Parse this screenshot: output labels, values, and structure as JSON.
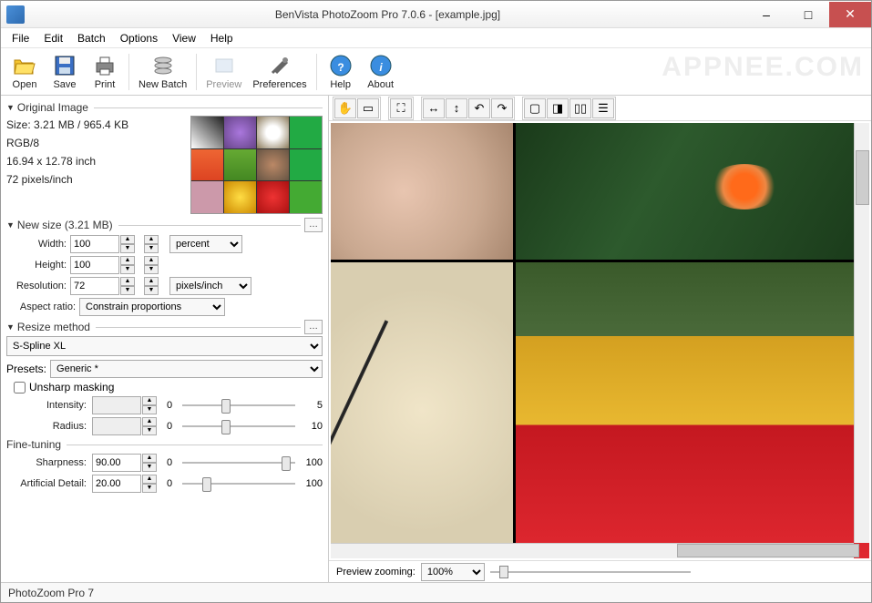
{
  "window": {
    "title": "BenVista PhotoZoom Pro 7.0.6 - [example.jpg]"
  },
  "menu": {
    "items": [
      "File",
      "Edit",
      "Batch",
      "Options",
      "View",
      "Help"
    ]
  },
  "toolbar": {
    "open": "Open",
    "save": "Save",
    "print": "Print",
    "newbatch": "New Batch",
    "preview": "Preview",
    "preferences": "Preferences",
    "help": "Help",
    "about": "About",
    "watermark": "APPNEE.COM"
  },
  "original": {
    "header": "Original Image",
    "size": "Size: 3.21 MB / 965.4 KB",
    "mode": "RGB/8",
    "dims": "16.94 x 12.78 inch",
    "res": "72 pixels/inch"
  },
  "newsize": {
    "header": "New size (3.21 MB)",
    "width_label": "Width:",
    "width": "100",
    "height_label": "Height:",
    "height": "100",
    "unit": "percent",
    "res_label": "Resolution:",
    "res": "72",
    "res_unit": "pixels/inch",
    "aspect_label": "Aspect ratio:",
    "aspect": "Constrain proportions"
  },
  "resize": {
    "header": "Resize method",
    "method": "S-Spline XL",
    "presets_label": "Presets:",
    "preset": "Generic *",
    "unsharp_label": "Unsharp masking",
    "intensity_label": "Intensity:",
    "intensity_val": "0",
    "intensity_max": "5",
    "radius_label": "Radius:",
    "radius_val": "0",
    "radius_max": "10",
    "finetune_label": "Fine-tuning",
    "sharp_label": "Sharpness:",
    "sharp": "90.00",
    "sharp_min": "0",
    "sharp_max": "100",
    "detail_label": "Artificial Detail:",
    "detail": "20.00",
    "detail_min": "0",
    "detail_max": "100"
  },
  "zoom": {
    "label": "Preview zooming:",
    "value": "100%"
  },
  "status": {
    "text": "PhotoZoom Pro 7"
  }
}
